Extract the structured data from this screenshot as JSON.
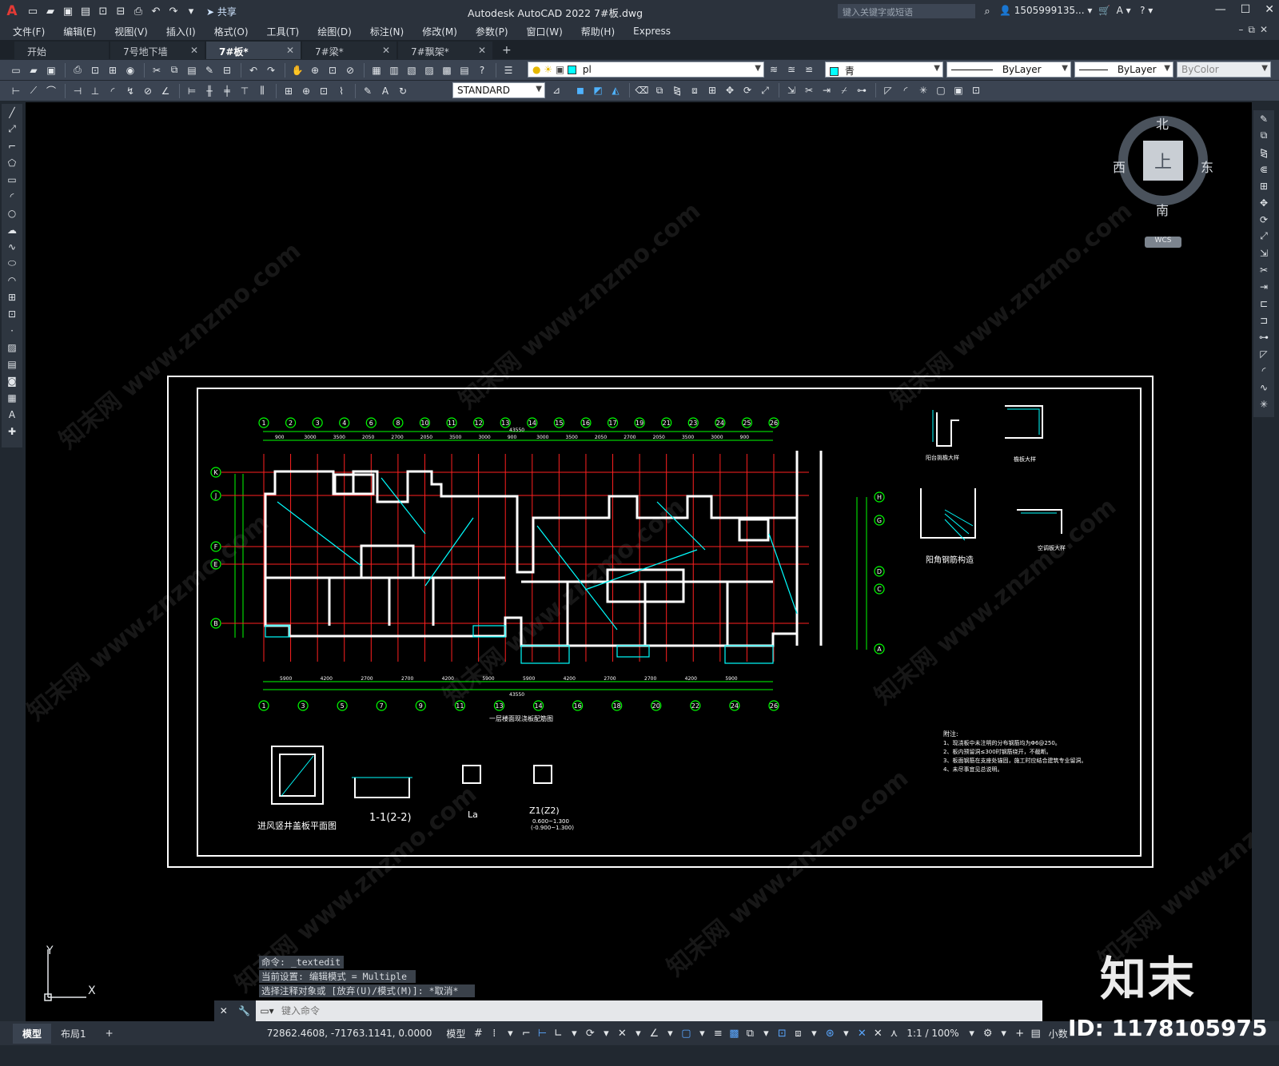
{
  "window": {
    "title": "Autodesk AutoCAD 2022   7#板.dwg",
    "logo": "A",
    "share_label": "共享",
    "search_placeholder": "键入关键字或短语",
    "user": "1505999135...",
    "controls": [
      "—",
      "☐",
      "✕"
    ]
  },
  "menu": {
    "items": [
      "文件(F)",
      "编辑(E)",
      "视图(V)",
      "插入(I)",
      "格式(O)",
      "工具(T)",
      "绘图(D)",
      "标注(N)",
      "修改(M)",
      "参数(P)",
      "窗口(W)",
      "帮助(H)",
      "Express"
    ]
  },
  "tabs": [
    {
      "label": "开始",
      "closable": false
    },
    {
      "label": "7号地下墙",
      "closable": true
    },
    {
      "label": "7#板*",
      "closable": true,
      "active": true
    },
    {
      "label": "7#梁*",
      "closable": true
    },
    {
      "label": "7#飘架*",
      "closable": true
    }
  ],
  "toolbar": {
    "layer_value": "pl",
    "color_value": "青",
    "color_hex": "#00ffff",
    "linetype_value": "ByLayer",
    "lineweight_value": "ByLayer",
    "plotstyle_value": "ByColor",
    "textstyle_value": "STANDARD"
  },
  "viewcube": {
    "north": "北",
    "south": "南",
    "east": "东",
    "west": "西",
    "face": "上",
    "wcs": "WCS"
  },
  "ucs": {
    "x": "X",
    "y": "Y"
  },
  "drawing": {
    "main_title": "一层楼面现浇板配筋图",
    "detail_shaft": "进风竖井盖板平面图",
    "section_1": "1-1(2-2)",
    "column_label": "Z1(Z2)",
    "column_note": "0.600~1.300",
    "column_note2": "(-0.900~1.300)",
    "la_label": "La",
    "detail_balcony": "阳台挑檐大样",
    "detail_corner": "阳角钢筋构造",
    "detail_parapet": "空调板大样",
    "detail_ledge": "檐板大样",
    "notes_title": "附注:",
    "notes": [
      "1、现浇板中未注明的分布钢筋均为Φ6@250。",
      "2、板内预留洞≤300时钢筋绕开，不截断。",
      "3、板面钢筋在支座处锚固，施工时应结合建筑专业留洞。",
      "4、未尽事宜见总说明。"
    ],
    "top_axes": [
      "1",
      "2",
      "3",
      "4",
      "6",
      "8",
      "10",
      "11",
      "12",
      "13",
      "14",
      "15",
      "16",
      "17",
      "19",
      "21",
      "23",
      "24",
      "25",
      "26"
    ],
    "bottom_axes": [
      "1",
      "3",
      "5",
      "7",
      "9",
      "11",
      "13",
      "14",
      "16",
      "18",
      "20",
      "22",
      "24",
      "26"
    ],
    "left_axes": [
      "K",
      "J",
      "F",
      "E",
      "B"
    ],
    "right_axes": [
      "H",
      "G",
      "D",
      "C",
      "A"
    ],
    "top_dims": [
      "900",
      "3000",
      "3500",
      "2050",
      "2700",
      "2050",
      "3500",
      "3000",
      "900",
      "3000",
      "3500",
      "2050",
      "2700",
      "2050",
      "3500",
      "3000",
      "900"
    ],
    "bottom_dims": [
      "5900",
      "4200",
      "2700",
      "2700",
      "4200",
      "5900",
      "5900",
      "4200",
      "2700",
      "2700",
      "4200",
      "5900"
    ],
    "total_dim": "43550"
  },
  "command": {
    "history": [
      "命令: _textedit",
      "当前设置: 编辑模式 = Multiple",
      "选择注释对象或 [放弃(U)/模式(M)]: *取消*"
    ],
    "placeholder": "键入命令"
  },
  "status": {
    "layout_tabs": [
      "模型",
      "布局1"
    ],
    "coords": "72862.4608, -71763.1141, 0.0000",
    "model_label": "模型",
    "scale": "1:1 / 100%",
    "units": "小数"
  },
  "brand": {
    "name": "知末",
    "id": "ID: 1178105975",
    "watermark": "知末网 www.znzmo.com"
  }
}
